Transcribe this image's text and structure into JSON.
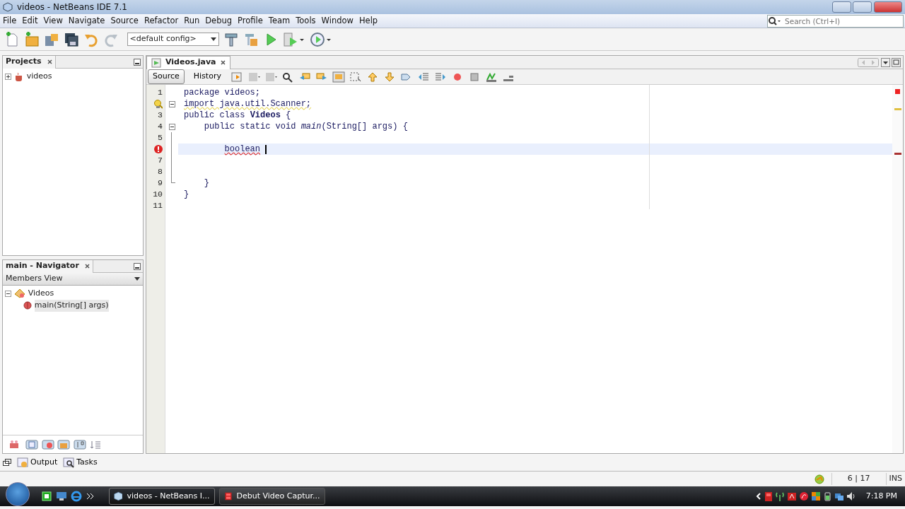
{
  "window": {
    "title": "videos - NetBeans IDE 7.1"
  },
  "menu": [
    "File",
    "Edit",
    "View",
    "Navigate",
    "Source",
    "Refactor",
    "Run",
    "Debug",
    "Profile",
    "Team",
    "Tools",
    "Window",
    "Help"
  ],
  "search": {
    "placeholder": "Search (Ctrl+I)"
  },
  "toolbar": {
    "config": "<default config>"
  },
  "projects_panel": {
    "title": "Projects",
    "tree": [
      {
        "label": "videos",
        "expanded": false
      }
    ]
  },
  "navigator": {
    "title": "main - Navigator",
    "view": "Members View",
    "tree": [
      {
        "label": "Videos",
        "expanded": true,
        "children": [
          {
            "label": "main(String[] args)",
            "selected": true
          }
        ]
      }
    ]
  },
  "editor": {
    "tabs": [
      {
        "label": "Videos.java",
        "selected": true
      }
    ],
    "views": [
      {
        "label": "Source",
        "selected": true
      },
      {
        "label": "History",
        "selected": false
      }
    ],
    "lines": [
      {
        "number": "1",
        "text": "package videos;"
      },
      {
        "text": "import java.util.Scanner;",
        "hint": true,
        "fold_start": true,
        "warning": true
      },
      {
        "number": "3",
        "text": "public class **Videos** {"
      },
      {
        "number": "4",
        "text": "    public static void *main*(String[] args) {",
        "fold_start": true
      },
      {
        "number": "5",
        "in_fold": true
      },
      {
        "text": "        boolean",
        "error": true,
        "current": true,
        "caret": true,
        "in_fold": true
      },
      {
        "number": "7",
        "in_fold": true
      },
      {
        "number": "8",
        "in_fold": true
      },
      {
        "number": "9",
        "text": "    }",
        "fold_end": true
      },
      {
        "number": "10",
        "text": "}"
      },
      {
        "number": "11"
      }
    ]
  },
  "bottom_tabs": [
    {
      "label": "Output",
      "kind": "output"
    },
    {
      "label": "Tasks",
      "kind": "tasks"
    }
  ],
  "status_bar": {
    "position": "6 | 17",
    "mode": "INS"
  },
  "taskbar": {
    "items": [
      {
        "label": "videos - NetBeans I...",
        "selected": true,
        "kind": "netbeans"
      },
      {
        "label": "Debut Video Captur...",
        "selected": false,
        "kind": "film"
      }
    ],
    "clock": "7:18 PM"
  }
}
